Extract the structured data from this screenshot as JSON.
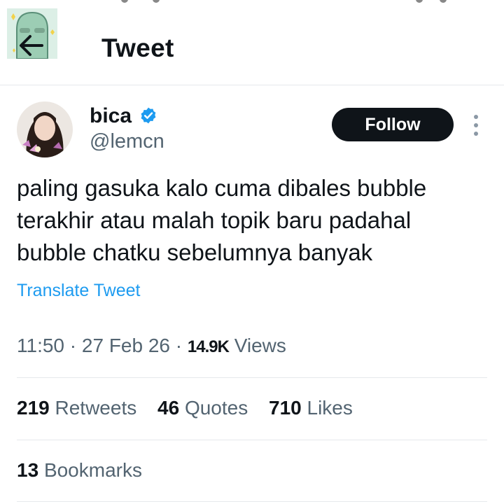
{
  "header": {
    "title": "Tweet"
  },
  "author": {
    "name": "bica",
    "handle": "@lemcn",
    "verified": true,
    "follow_label": "Follow"
  },
  "tweet": {
    "text": "paling gasuka kalo cuma dibales bubble terakhir atau malah topik baru padahal bubble chatku sebelumnya banyak",
    "translate_label": "Translate Tweet",
    "time": "11:50",
    "date": "27 Feb 26",
    "views_count": "14.9K",
    "views_label": "Views",
    "separator": "·"
  },
  "stats": {
    "retweets": {
      "count": "219",
      "label": "Retweets"
    },
    "quotes": {
      "count": "46",
      "label": "Quotes"
    },
    "likes": {
      "count": "710",
      "label": "Likes"
    },
    "bookmarks": {
      "count": "13",
      "label": "Bookmarks"
    }
  },
  "icons": {
    "back": "arrow-left-icon",
    "verified": "verified-badge-icon",
    "more": "more-vertical-icon"
  },
  "colors": {
    "accent": "#1d9bf0",
    "text": "#0f1419",
    "secondary": "#536471",
    "follow_bg": "#0f1419",
    "divider": "#e6e9ec"
  }
}
